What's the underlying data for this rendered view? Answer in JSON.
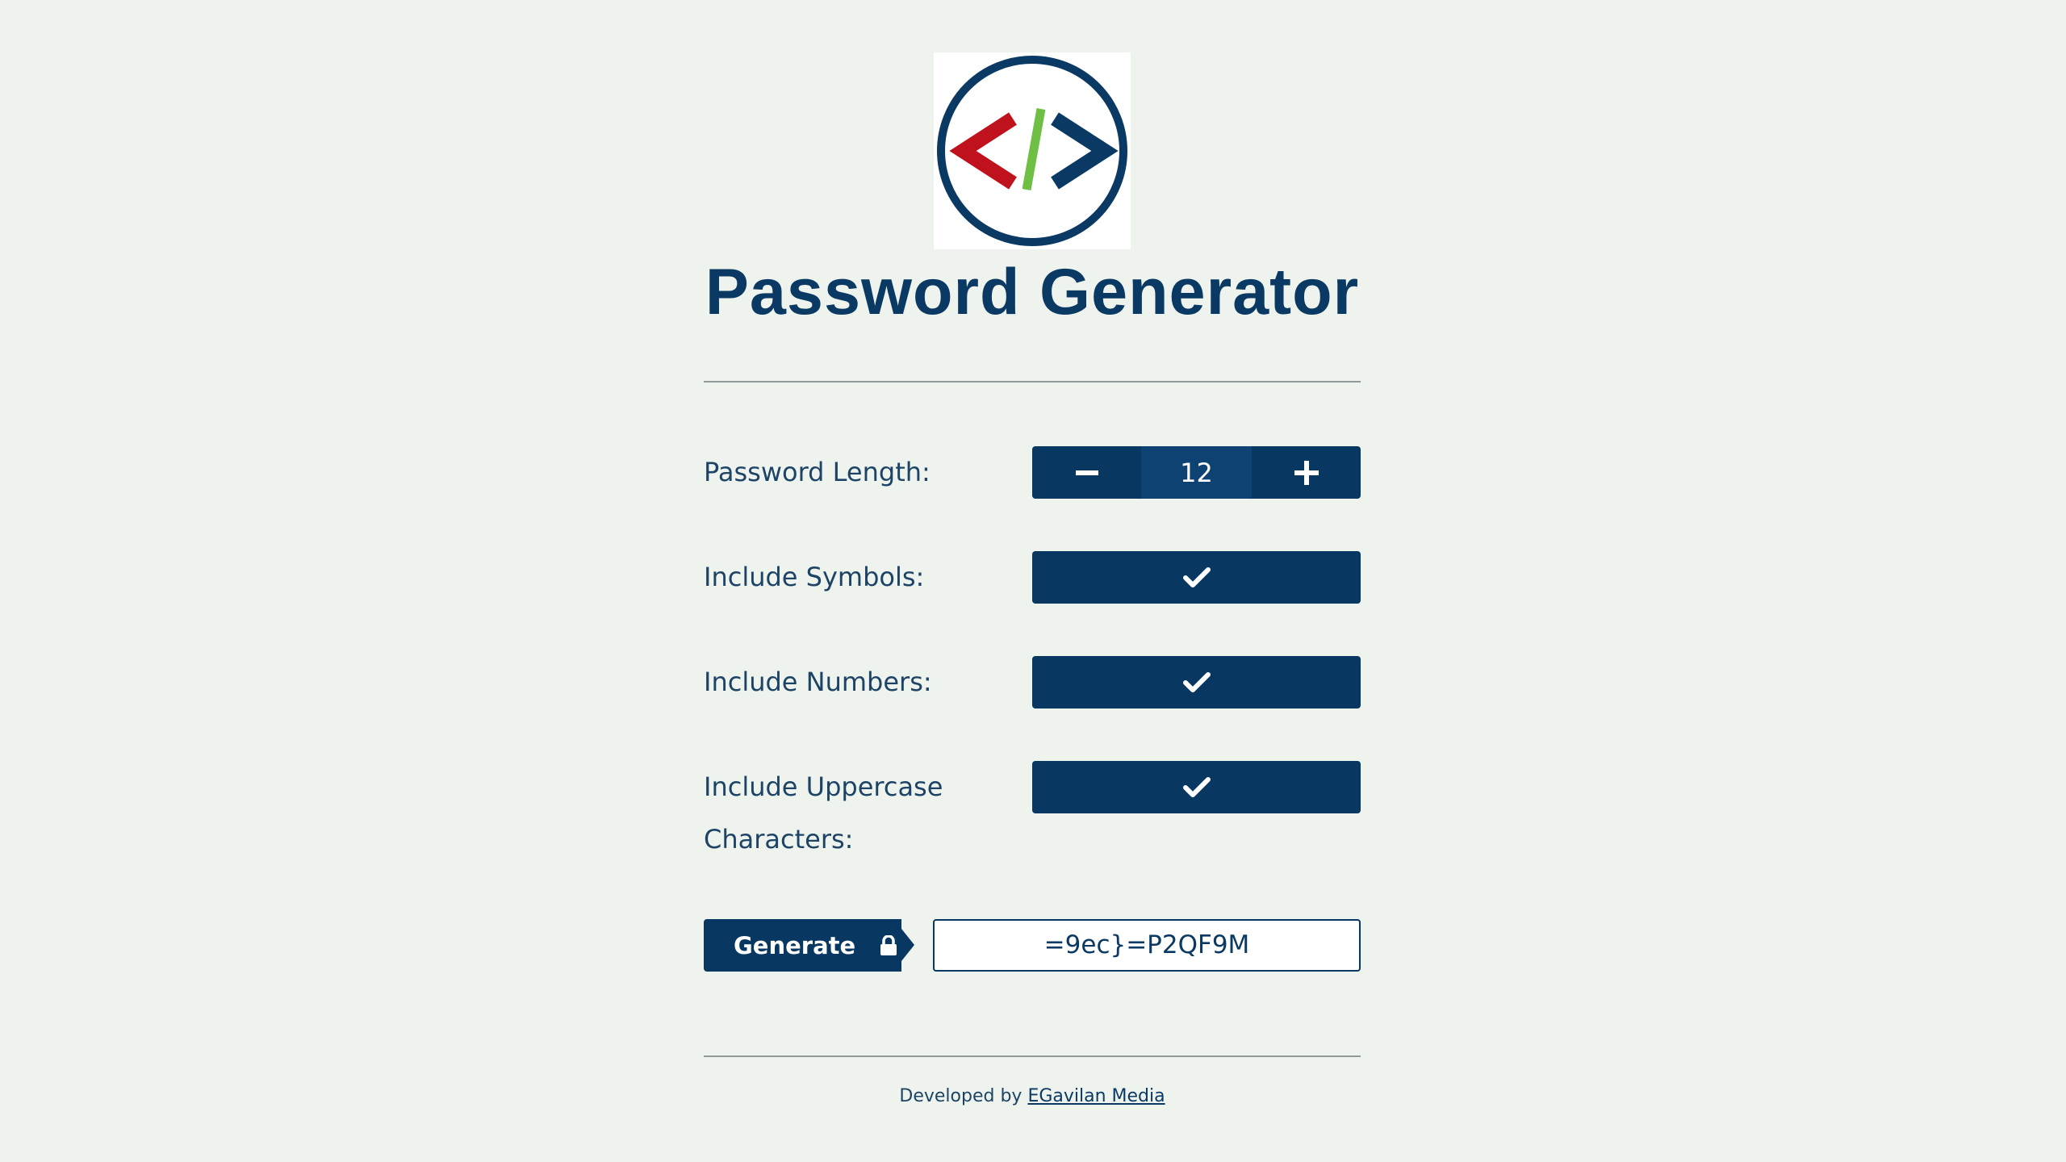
{
  "header": {
    "title": "Password Generator"
  },
  "settings": {
    "length_label": "Password Length:",
    "length_value": "12",
    "symbols_label": "Include Symbols:",
    "symbols_checked": true,
    "numbers_label": "Include Numbers:",
    "numbers_checked": true,
    "uppercase_label": "Include Uppercase Characters:",
    "uppercase_checked": true
  },
  "actions": {
    "generate_label": "Generate",
    "password_value": "=9ec}=P2QF9M"
  },
  "footer": {
    "prefix": "Developed by",
    "link_text": "EGavilan Media"
  },
  "colors": {
    "background": "#eff3ed",
    "primary": "#083761",
    "logo_red": "#c0121d",
    "logo_green": "#6fbf44"
  },
  "icons": {
    "logo": "code-brackets-logo-icon",
    "minus": "minus-icon",
    "plus": "plus-icon",
    "check": "check-icon",
    "lock": "lock-icon"
  }
}
